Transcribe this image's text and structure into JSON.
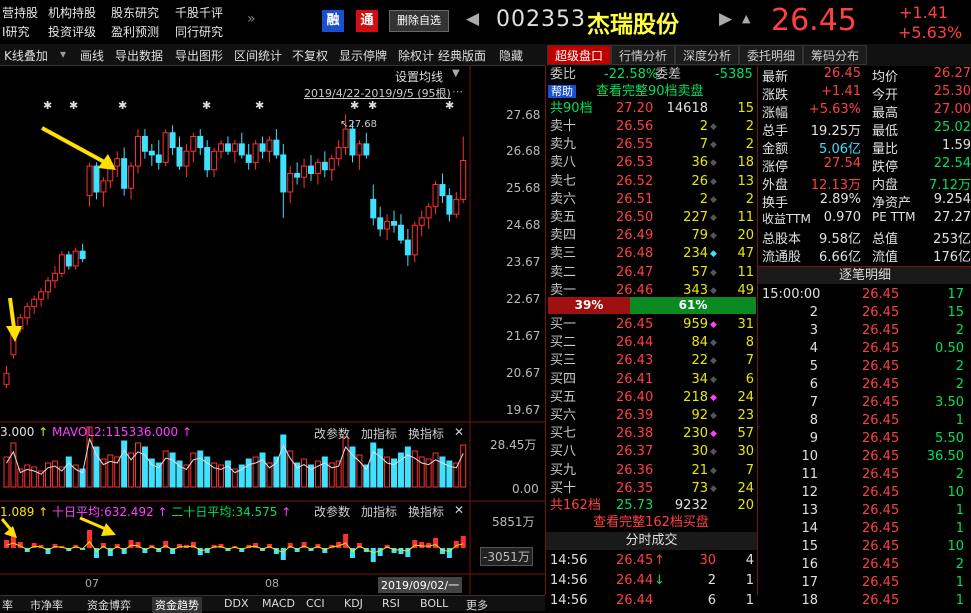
{
  "top_links": [
    [
      "营持股",
      "机构持股",
      "股东研究",
      "千股千评"
    ],
    [
      "I研究",
      "投资评级",
      "盈利预测",
      "同行研究"
    ]
  ],
  "more": "»",
  "badges": {
    "rong": "融",
    "tong": "通"
  },
  "delete_label": "删除自选",
  "stock": {
    "code": "002353",
    "name": "杰瑞股份",
    "price": "26.45",
    "change": "+1.41",
    "pct": "+5.63%"
  },
  "toolbar": [
    "K线叠加",
    "画线",
    "导出数据",
    "导出图形",
    "区间统计",
    "不复权",
    "显示停牌",
    "除权计",
    "经典版面",
    "隐藏"
  ],
  "right_tabs": [
    "超级盘口",
    "行情分析",
    "深度分析",
    "委托明细",
    "筹码分布"
  ],
  "chart": {
    "settings_label": "设置均线",
    "range_label": "2019/4/22-2019/9/5 (95根)",
    "high_label": "27.68",
    "price_ticks": [
      "27.68",
      "26.68",
      "25.68",
      "24.68",
      "23.67",
      "22.67",
      "21.67",
      "20.67",
      "19.67"
    ],
    "vol_header": "3.000",
    "vol_ma2": "MAVOL2:115336.000",
    "vol_btns": [
      "改参数",
      "加指标",
      "换指标"
    ],
    "vol_ticks": [
      "28.45万",
      "0.00"
    ],
    "fund_header": "1.089",
    "fund_ma10": "十日平均:632.492",
    "fund_ma20": "二十日平均:34.575",
    "fund_btns": [
      "改参数",
      "加指标",
      "换指标"
    ],
    "fund_ticks": [
      "5851万",
      "-3051万"
    ],
    "month_labels": [
      "07",
      "08"
    ],
    "date_cursor": "2019/09/02/一"
  },
  "order_book": {
    "weibi_label": "委比",
    "weibi_val": "-22.58%",
    "weicha_label": "委差",
    "weicha_val": "-5385",
    "help": "帮助",
    "view_sell": "查看完整90档卖盘",
    "sell_total": {
      "label": "共90档",
      "price": "27.20",
      "vol": "14618",
      "n": "15"
    },
    "sells": [
      {
        "label": "卖十",
        "price": "26.56",
        "vol": "2",
        "n": "2"
      },
      {
        "label": "卖九",
        "price": "26.55",
        "vol": "7",
        "n": "2"
      },
      {
        "label": "卖八",
        "price": "26.53",
        "vol": "36",
        "n": "18"
      },
      {
        "label": "卖七",
        "price": "26.52",
        "vol": "26",
        "n": "13"
      },
      {
        "label": "卖六",
        "price": "26.51",
        "vol": "2",
        "n": "2"
      },
      {
        "label": "卖五",
        "price": "26.50",
        "vol": "227",
        "n": "11"
      },
      {
        "label": "卖四",
        "price": "26.49",
        "vol": "79",
        "n": "20"
      },
      {
        "label": "卖三",
        "price": "26.48",
        "vol": "234",
        "n": "47"
      },
      {
        "label": "卖二",
        "price": "26.47",
        "vol": "57",
        "n": "11"
      },
      {
        "label": "卖一",
        "price": "26.46",
        "vol": "343",
        "n": "49"
      }
    ],
    "ratio_sell": "39%",
    "ratio_buy": "61%",
    "buys": [
      {
        "label": "买一",
        "price": "26.45",
        "vol": "959",
        "n": "31"
      },
      {
        "label": "买二",
        "price": "26.44",
        "vol": "84",
        "n": "8"
      },
      {
        "label": "买三",
        "price": "26.43",
        "vol": "22",
        "n": "7"
      },
      {
        "label": "买四",
        "price": "26.41",
        "vol": "34",
        "n": "6"
      },
      {
        "label": "买五",
        "price": "26.40",
        "vol": "218",
        "n": "24"
      },
      {
        "label": "买六",
        "price": "26.39",
        "vol": "92",
        "n": "23"
      },
      {
        "label": "买七",
        "price": "26.38",
        "vol": "230",
        "n": "57"
      },
      {
        "label": "买八",
        "price": "26.37",
        "vol": "30",
        "n": "30"
      },
      {
        "label": "买九",
        "price": "26.36",
        "vol": "21",
        "n": "7"
      },
      {
        "label": "买十",
        "price": "26.35",
        "vol": "73",
        "n": "24"
      }
    ],
    "buy_total": {
      "label": "共162档",
      "price": "25.73",
      "vol": "9232",
      "n": "20"
    },
    "view_buy": "查看完整162档买盘"
  },
  "timeshare": {
    "title": "分时成交",
    "rows": [
      {
        "t": "14:56",
        "p": "26.45",
        "arrow": "↑",
        "v": "30",
        "n": "4"
      },
      {
        "t": "14:56",
        "p": "26.44",
        "arrow": "↓",
        "v": "2",
        "n": "1"
      },
      {
        "t": "14:56",
        "p": "26.44",
        "arrow": "",
        "v": "6",
        "n": "1"
      }
    ]
  },
  "quote": [
    [
      {
        "k": "最新",
        "v": "26.45",
        "c": "red"
      },
      {
        "k": "均价",
        "v": "26.27",
        "c": "red"
      }
    ],
    [
      {
        "k": "涨跌",
        "v": "+1.41",
        "c": "red"
      },
      {
        "k": "今开",
        "v": "25.30",
        "c": "red"
      }
    ],
    [
      {
        "k": "涨幅",
        "v": "+5.63%",
        "c": "red"
      },
      {
        "k": "最高",
        "v": "27.00",
        "c": "red"
      }
    ],
    [
      {
        "k": "总手",
        "v": "19.25万",
        "c": "white"
      },
      {
        "k": "最低",
        "v": "25.02",
        "c": "green"
      }
    ],
    [
      {
        "k": "金额",
        "v": "5.06亿",
        "c": "cyan"
      },
      {
        "k": "量比",
        "v": "1.59",
        "c": "white"
      }
    ],
    [
      {
        "k": "涨停",
        "v": "27.54",
        "c": "red"
      },
      {
        "k": "跌停",
        "v": "22.54",
        "c": "green"
      }
    ],
    [
      {
        "k": "外盘",
        "v": "12.13万",
        "c": "red"
      },
      {
        "k": "内盘",
        "v": "7.12万",
        "c": "green"
      }
    ],
    [
      {
        "k": "换手",
        "v": "2.89%",
        "c": "white"
      },
      {
        "k": "净资产",
        "v": "9.254",
        "c": "white"
      }
    ],
    [
      {
        "k": "收益TTM",
        "v": "0.970",
        "c": "white"
      },
      {
        "k": "PE TTM",
        "v": "27.27",
        "c": "white"
      }
    ],
    [
      {
        "k": "总股本",
        "v": "9.58亿",
        "c": "white"
      },
      {
        "k": "总值",
        "v": "253亿",
        "c": "white"
      }
    ],
    [
      {
        "k": "流通股",
        "v": "6.66亿",
        "c": "white"
      },
      {
        "k": "流值",
        "v": "176亿",
        "c": "white"
      }
    ]
  ],
  "ticks_title": "逐笔明细",
  "ticks": [
    {
      "t": "15:00:00",
      "p": "26.45",
      "v": "17"
    },
    {
      "t": "2",
      "p": "26.45",
      "v": "15"
    },
    {
      "t": "3",
      "p": "26.45",
      "v": "2"
    },
    {
      "t": "4",
      "p": "26.45",
      "v": "0.50"
    },
    {
      "t": "5",
      "p": "26.45",
      "v": "2"
    },
    {
      "t": "6",
      "p": "26.45",
      "v": "2"
    },
    {
      "t": "7",
      "p": "26.45",
      "v": "3.50"
    },
    {
      "t": "8",
      "p": "26.45",
      "v": "1"
    },
    {
      "t": "9",
      "p": "26.45",
      "v": "5.50"
    },
    {
      "t": "10",
      "p": "26.45",
      "v": "36.50"
    },
    {
      "t": "11",
      "p": "26.45",
      "v": "2"
    },
    {
      "t": "12",
      "p": "26.45",
      "v": "10"
    },
    {
      "t": "13",
      "p": "26.45",
      "v": "1"
    },
    {
      "t": "14",
      "p": "26.45",
      "v": "1"
    },
    {
      "t": "15",
      "p": "26.45",
      "v": "10"
    },
    {
      "t": "16",
      "p": "26.45",
      "v": "2"
    },
    {
      "t": "17",
      "p": "26.45",
      "v": "1"
    },
    {
      "t": "18",
      "p": "26.45",
      "v": "1"
    }
  ],
  "bottom_tabs": [
    "率",
    "市净率",
    "资金博弈",
    "资金趋势",
    "DDX",
    "MACD",
    "CCI",
    "KDJ",
    "RSI",
    "BOLL",
    "更多"
  ],
  "candles": [
    [
      20.4,
      20.9,
      20.3,
      20.7
    ],
    [
      21.2,
      22.0,
      21.1,
      21.9
    ],
    [
      21.9,
      22.3,
      21.8,
      22.2
    ],
    [
      22.2,
      22.6,
      22.0,
      22.5
    ],
    [
      22.5,
      22.8,
      22.3,
      22.7
    ],
    [
      22.7,
      23.0,
      22.5,
      22.9
    ],
    [
      22.9,
      23.3,
      22.7,
      23.2
    ],
    [
      23.2,
      23.6,
      23.0,
      23.4
    ],
    [
      23.4,
      24.0,
      23.3,
      23.9
    ],
    [
      23.9,
      24.0,
      23.5,
      23.6
    ],
    [
      23.6,
      24.1,
      23.5,
      24.0
    ],
    [
      24.0,
      24.2,
      23.7,
      23.8
    ],
    [
      25.5,
      26.4,
      25.2,
      26.3
    ],
    [
      26.3,
      26.4,
      25.4,
      25.6
    ],
    [
      25.6,
      26.0,
      25.2,
      25.9
    ],
    [
      25.9,
      26.5,
      25.7,
      26.3
    ],
    [
      26.3,
      26.7,
      26.0,
      26.5
    ],
    [
      26.5,
      26.8,
      25.5,
      25.7
    ],
    [
      25.7,
      26.4,
      25.4,
      26.3
    ],
    [
      26.3,
      27.3,
      26.1,
      27.1
    ],
    [
      27.1,
      27.3,
      26.5,
      26.7
    ],
    [
      26.7,
      26.9,
      26.3,
      26.6
    ],
    [
      26.6,
      27.0,
      26.2,
      26.4
    ],
    [
      26.4,
      27.3,
      26.3,
      27.2
    ],
    [
      27.2,
      27.4,
      26.6,
      26.8
    ],
    [
      26.8,
      27.1,
      26.2,
      26.3
    ],
    [
      26.3,
      26.9,
      26.0,
      26.7
    ],
    [
      26.7,
      27.2,
      26.4,
      27.1
    ],
    [
      27.1,
      27.3,
      26.6,
      26.8
    ],
    [
      26.8,
      27.0,
      26.0,
      26.2
    ],
    [
      26.2,
      26.8,
      26.0,
      26.7
    ],
    [
      26.7,
      27.0,
      26.5,
      26.9
    ],
    [
      26.9,
      27.1,
      26.6,
      26.7
    ],
    [
      26.7,
      27.0,
      26.4,
      26.9
    ],
    [
      26.9,
      27.2,
      26.5,
      26.6
    ],
    [
      26.6,
      26.9,
      26.2,
      26.4
    ],
    [
      26.4,
      27.0,
      26.2,
      26.9
    ],
    [
      26.9,
      27.1,
      26.5,
      26.7
    ],
    [
      26.7,
      27.1,
      26.4,
      27.0
    ],
    [
      27.0,
      27.3,
      26.5,
      26.6
    ],
    [
      26.6,
      26.9,
      24.9,
      25.6
    ],
    [
      25.6,
      26.3,
      25.3,
      26.1
    ],
    [
      26.1,
      26.4,
      25.8,
      26.0
    ],
    [
      26.0,
      26.5,
      25.7,
      26.3
    ],
    [
      26.3,
      26.6,
      25.9,
      26.1
    ],
    [
      26.1,
      26.5,
      25.8,
      26.4
    ],
    [
      26.4,
      26.7,
      26.0,
      26.2
    ],
    [
      26.2,
      26.6,
      25.9,
      26.5
    ],
    [
      26.5,
      27.0,
      26.3,
      26.8
    ],
    [
      26.8,
      27.7,
      26.6,
      27.3
    ],
    [
      27.3,
      27.5,
      26.4,
      26.6
    ],
    [
      26.6,
      27.0,
      26.2,
      26.9
    ],
    [
      26.9,
      27.2,
      26.5,
      26.6
    ],
    [
      25.4,
      25.8,
      24.7,
      24.9
    ],
    [
      24.9,
      25.2,
      24.4,
      24.6
    ],
    [
      24.6,
      25.0,
      24.3,
      24.8
    ],
    [
      24.8,
      25.1,
      24.5,
      24.7
    ],
    [
      24.7,
      25.0,
      24.2,
      24.3
    ],
    [
      24.3,
      24.6,
      23.6,
      23.9
    ],
    [
      23.9,
      24.8,
      23.7,
      24.7
    ],
    [
      24.7,
      25.1,
      24.4,
      24.9
    ],
    [
      24.9,
      25.3,
      24.6,
      25.2
    ],
    [
      25.2,
      25.9,
      25.0,
      25.8
    ],
    [
      25.8,
      26.1,
      25.3,
      25.5
    ],
    [
      25.5,
      25.7,
      24.8,
      25.0
    ],
    [
      25.0,
      25.6,
      24.9,
      25.4
    ],
    [
      25.4,
      27.1,
      25.3,
      26.45
    ]
  ]
}
